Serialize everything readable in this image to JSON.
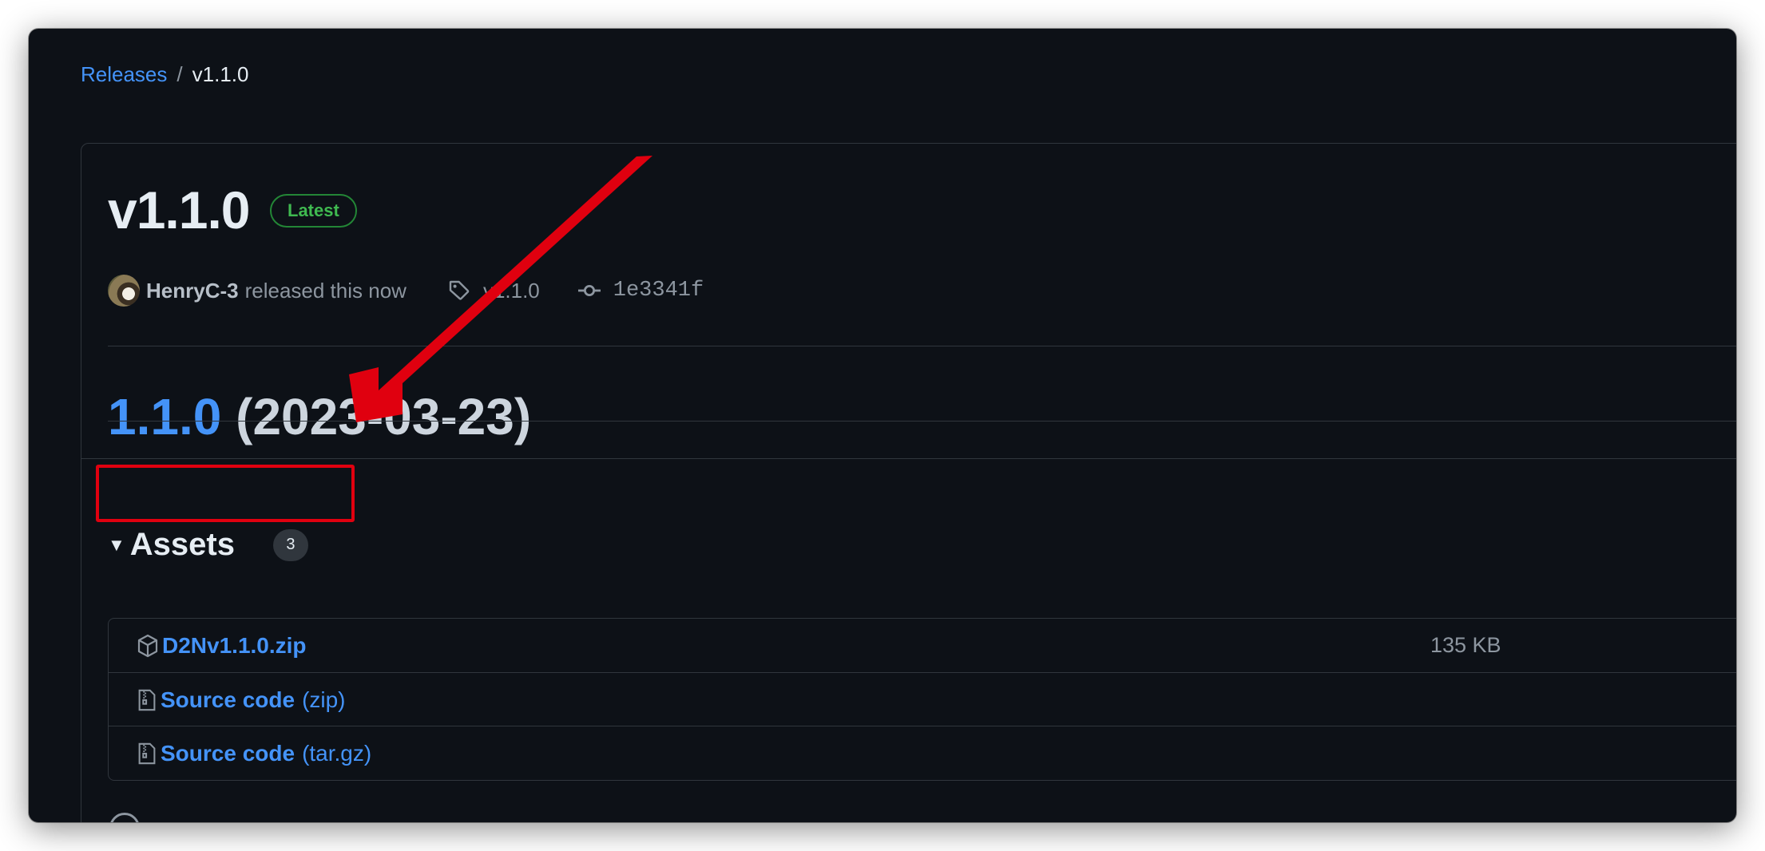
{
  "breadcrumb": {
    "parent": "Releases",
    "separator": "/",
    "current": "v1.1.0"
  },
  "release": {
    "title": "v1.1.0",
    "badge": "Latest",
    "author": "HenryC-3",
    "released_text": "released this now",
    "tag": "v1.1.0",
    "commit": "1e3341f",
    "heading_version": "1.1.0",
    "heading_date": "(2023-03-23)"
  },
  "assets": {
    "title": "Assets",
    "count": "3",
    "items": [
      {
        "name": "D2Nv1.1.0.zip",
        "suffix": "",
        "size": "135 KB",
        "icon": "package-icon"
      },
      {
        "name": "Source code",
        "suffix": "(zip)",
        "size": "",
        "icon": "file-zip-icon"
      },
      {
        "name": "Source code",
        "suffix": "(tar.gz)",
        "size": "",
        "icon": "file-zip-icon"
      }
    ]
  },
  "colors": {
    "link": "#4493f8",
    "background": "#0d1117",
    "border": "#30363d",
    "latest_badge": "#3fb950",
    "annotation": "#e0000f"
  }
}
